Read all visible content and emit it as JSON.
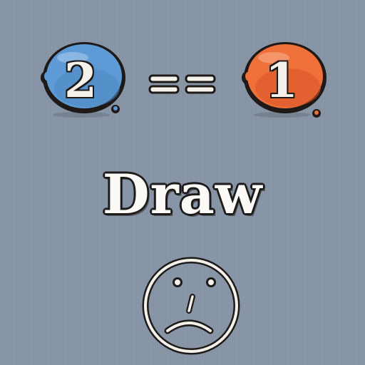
{
  "equation": {
    "left_value": "2",
    "operator": "==",
    "right_value": "1"
  },
  "result": {
    "text": "Draw",
    "face": "sad-face-icon"
  },
  "colors": {
    "background": "#8794a6",
    "left_ball": "#5e9bd6",
    "right_ball": "#f0703a",
    "outline": "#1f1a18",
    "text_fill": "#f4f1ea"
  }
}
